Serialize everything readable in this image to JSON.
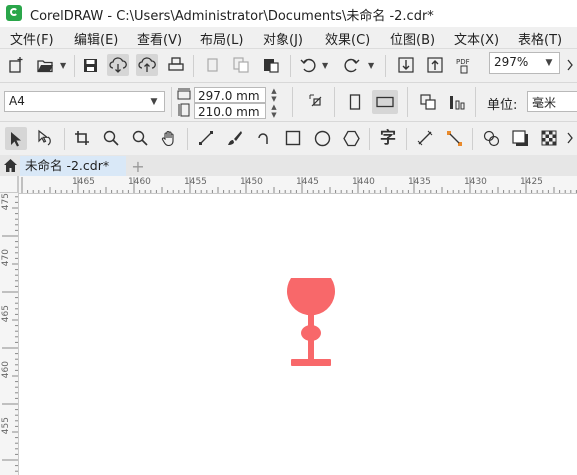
{
  "app": {
    "title": "CorelDRAW - C:\\Users\\Administrator\\Documents\\未命名 -2.cdr*"
  },
  "menu": [
    {
      "label": "文件(F)"
    },
    {
      "label": "编辑(E)"
    },
    {
      "label": "查看(V)"
    },
    {
      "label": "布局(L)"
    },
    {
      "label": "对象(J)"
    },
    {
      "label": "效果(C)"
    },
    {
      "label": "位图(B)"
    },
    {
      "label": "文本(X)"
    },
    {
      "label": "表格(T)"
    }
  ],
  "toolbar": {
    "zoom_value": "297%"
  },
  "property_bar": {
    "paper_size": "A4",
    "width": "297.0 mm",
    "height": "210.0 mm",
    "unit_label": "单位:",
    "unit_value": "毫米"
  },
  "toolbox": {
    "text_tool_glyph": "字"
  },
  "document": {
    "tab_label": "未命名 -2.cdr*",
    "add_tab": "+"
  },
  "ruler": {
    "horizontal_ticks": [
      "1465",
      "1460",
      "1455",
      "1450",
      "1445",
      "1440",
      "1435",
      "1430",
      "1425"
    ],
    "vertical_ticks": [
      "475",
      "470",
      "465",
      "460",
      "455"
    ]
  },
  "colors": {
    "shape_fill": "#f8686a",
    "tab_active": "#d9e8f7",
    "logo": "#2aa64a"
  }
}
